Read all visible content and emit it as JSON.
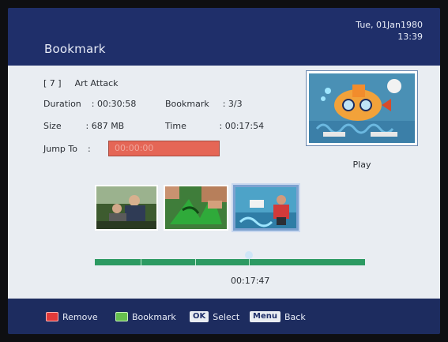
{
  "header": {
    "title": "Bookmark",
    "date": "Tue, 01Jan1980",
    "time": "13:39"
  },
  "program": {
    "number": "[ 7 ]",
    "name": "Art Attack"
  },
  "info": {
    "duration_label": "Duration",
    "duration_value": ": 00:30:58",
    "bookmark_label": "Bookmark",
    "bookmark_value": ": 3/3",
    "size_label": "Size",
    "size_value": ": 687 MB",
    "time_label": "Time",
    "time_value": ": 00:17:54"
  },
  "jump_to": {
    "label": "Jump To",
    "separator": ":",
    "value": "00:00:00"
  },
  "preview": {
    "play_label": "Play"
  },
  "thumbnails": {
    "selected_index": 2,
    "items": [
      {
        "icon": "person-thumbnail"
      },
      {
        "icon": "paper-craft-thumbnail"
      },
      {
        "icon": "kid-thumbnail"
      }
    ]
  },
  "timeline": {
    "current_time": "00:17:47",
    "position_fraction": 0.57,
    "bookmark_fractions": [
      0.17,
      0.37,
      0.57
    ]
  },
  "footer": {
    "remove": "Remove",
    "bookmark": "Bookmark",
    "ok_key": "OK",
    "select": "Select",
    "menu_key": "Menu",
    "back": "Back"
  },
  "colors": {
    "header_bg": "#1f2f6a",
    "content_bg": "#e9edf2",
    "accent_red": "#e56656",
    "progress_green": "#2c9a62"
  }
}
